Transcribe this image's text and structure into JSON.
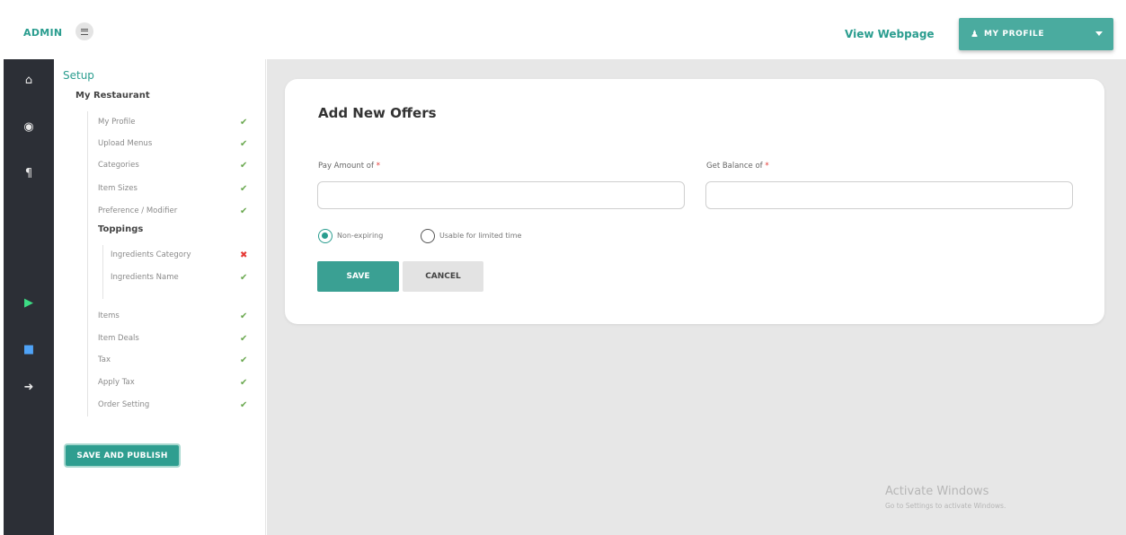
{
  "header": {
    "brand": "ADMIN",
    "view_link": "View Webpage",
    "profile_label": "MY PROFILE"
  },
  "rail": {
    "icons": [
      "home-icon",
      "box-icon",
      "utensils-icon",
      "google-play-icon",
      "app-store-icon",
      "logout-icon"
    ]
  },
  "sidebar": {
    "title": "Setup",
    "restaurant": "My Restaurant",
    "items": [
      {
        "label": "My Profile",
        "status": "done"
      },
      {
        "label": "Upload Menus",
        "status": "done"
      },
      {
        "label": "Categories",
        "status": "done"
      },
      {
        "label": "Item Sizes",
        "status": "done"
      },
      {
        "label": "Preference / Modifier",
        "status": "done"
      },
      {
        "label": "Toppings",
        "status": ""
      },
      {
        "label": "Ingredients Category",
        "status": "missing"
      },
      {
        "label": "Ingredients Name",
        "status": "done"
      },
      {
        "label": "Items",
        "status": "done"
      },
      {
        "label": "Item Deals",
        "status": "done"
      },
      {
        "label": "Tax",
        "status": "done"
      },
      {
        "label": "Apply Tax",
        "status": "done"
      },
      {
        "label": "Order Setting",
        "status": "done"
      }
    ],
    "publish_label": "SAVE AND PUBLISH"
  },
  "form": {
    "title": "Add New Offers",
    "pay_label": "Pay Amount of",
    "get_label": "Get Balance of",
    "required_mark": "*",
    "pay_value": "",
    "get_value": "",
    "option_non_expiring": "Non-expiring",
    "option_limited": "Usable for limited time",
    "selected_option": "Non-expiring",
    "save_label": "SAVE",
    "cancel_label": "CANCEL"
  },
  "watermark": {
    "line1": "Activate Windows",
    "line2": "Go to Settings to activate Windows."
  },
  "colors": {
    "accent": "#2a9d8f",
    "sidebar_dark": "#2c2f36",
    "check": "#6aa84f",
    "cross": "#e53935"
  }
}
